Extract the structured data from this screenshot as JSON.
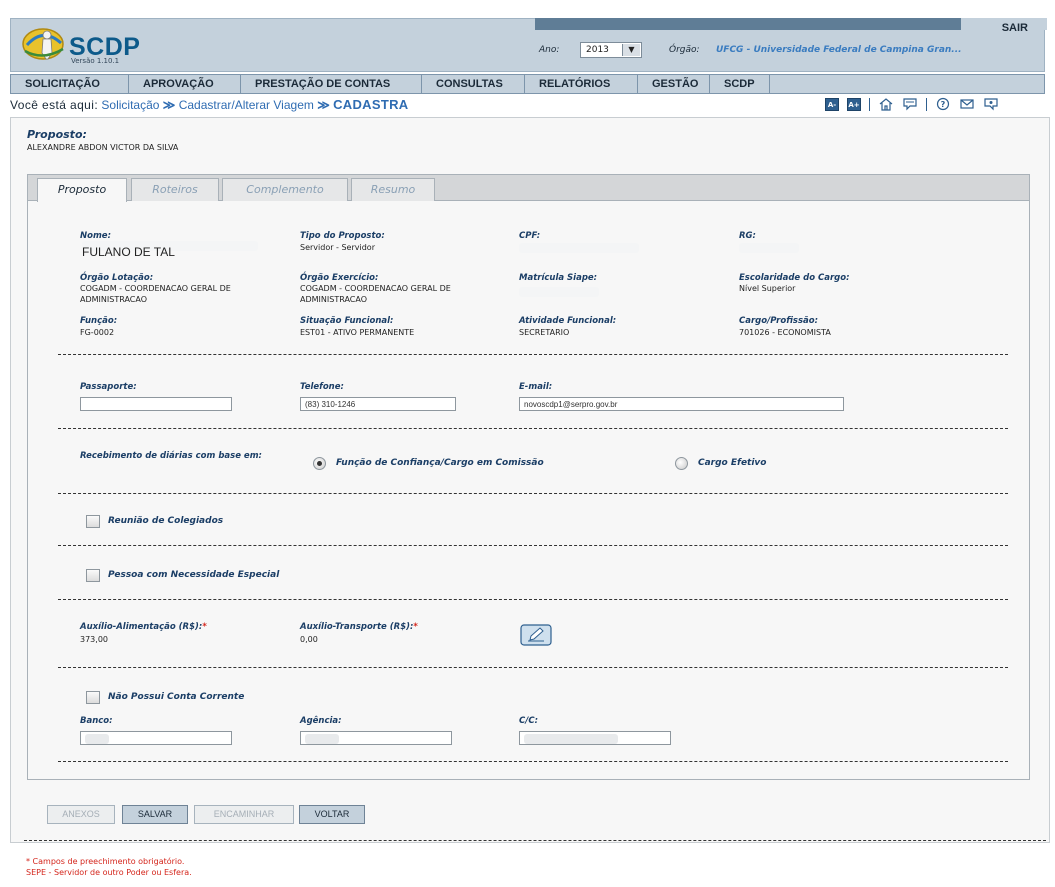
{
  "header": {
    "logo_text": "SCDP",
    "version": "Versão 1.10.1",
    "logout": "SAIR",
    "ano_label": "Ano:",
    "ano_value": "2013",
    "orgao_label": "Órgão:",
    "orgao_value": "UFCG - Universidade Federal de Campina Gran..."
  },
  "menu": [
    "SOLICITAÇÃO",
    "APROVAÇÃO",
    "PRESTAÇÃO DE CONTAS",
    "CONSULTAS",
    "RELATÓRIOS",
    "GESTÃO",
    "SCDP"
  ],
  "breadcrumb": {
    "prefix": "Você está aqui:",
    "items": [
      "Solicitação",
      "Cadastrar/Alterar Viagem"
    ],
    "separator": "≫",
    "current": "CADASTRA"
  },
  "tools": {
    "font_decrease": "A-",
    "font_increase": "A+"
  },
  "proposto": {
    "title": "Proposto:",
    "name": "ALEXANDRE ABDON VICTOR DA SILVA"
  },
  "tabs": [
    "Proposto",
    "Roteiros",
    "Complemento",
    "Resumo"
  ],
  "fields": {
    "nome_label": "Nome:",
    "nome_value": "FULANO DE TAL",
    "tipo_label": "Tipo do Proposto:",
    "tipo_value": "Servidor - Servidor",
    "cpf_label": "CPF:",
    "rg_label": "RG:",
    "orgao_lotacao_label": "Órgão Lotação:",
    "orgao_lotacao_value": "COGADM - COORDENACAO GERAL DE ADMINISTRACAO",
    "orgao_exercicio_label": "Órgão Exercício:",
    "orgao_exercicio_value": "COGADM - COORDENACAO GERAL DE ADMINISTRACAO",
    "matricula_label": "Matrícula Siape:",
    "escolaridade_label": "Escolaridade do Cargo:",
    "escolaridade_value": "Nível Superior",
    "funcao_label": "Função:",
    "funcao_value": "FG-0002",
    "situacao_label": "Situação Funcional:",
    "situacao_value": "EST01 - ATIVO PERMANENTE",
    "atividade_label": "Atividade Funcional:",
    "atividade_value": "SECRETARIO",
    "cargo_label": "Cargo/Profissão:",
    "cargo_value": "701026 - ECONOMISTA",
    "passaporte_label": "Passaporte:",
    "passaporte_value": "",
    "telefone_label": "Telefone:",
    "telefone_value": "(83) 310-1246",
    "email_label": "E-mail:",
    "email_value": "novoscdp1@serpro.gov.br",
    "recebimento_label": "Recebimento de diárias com base em:",
    "radio_funcao": "Função de Confiança/Cargo em Comissão",
    "radio_cargo": "Cargo Efetivo",
    "reuniao_label": "Reunião de Colegiados",
    "necessidade_label": "Pessoa com Necessidade Especial",
    "auxilio_alimentacao_label": "Auxílio-Alimentação (R$):",
    "auxilio_alimentacao_value": "373,00",
    "auxilio_transporte_label": "Auxílio-Transporte (R$):",
    "auxilio_transporte_value": "0,00",
    "required_mark": "*",
    "conta_label": "Não Possui Conta Corrente",
    "banco_label": "Banco:",
    "agencia_label": "Agência:",
    "cc_label": "C/C:"
  },
  "buttons": {
    "anexos": "ANEXOS",
    "salvar": "SALVAR",
    "encaminhar": "ENCAMINHAR",
    "voltar": "VOLTAR"
  },
  "footer": {
    "note1": "* Campos de preechimento obrigatório.",
    "note2": "SEPE - Servidor de outro Poder ou Esfera."
  }
}
